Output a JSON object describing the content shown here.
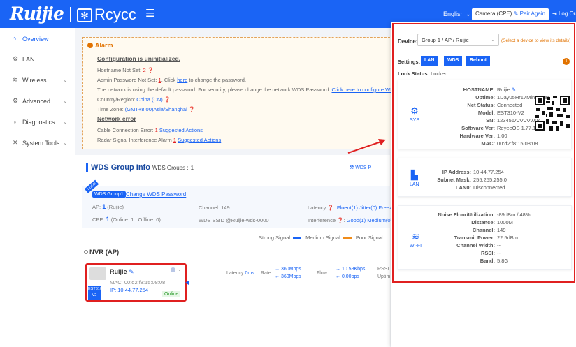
{
  "header": {
    "brand_logo": "Ruijie",
    "reyee_logo": "Rcycc",
    "menu_icon": "hamburger-icon",
    "language": "English",
    "camera_button_label": "Camera (CPE)",
    "pair_again_label": "Pair Again",
    "logout_label": "Log Out"
  },
  "sidebar": {
    "items": [
      {
        "label": "Overview",
        "icon": "home-icon"
      },
      {
        "label": "LAN",
        "icon": "network-icon"
      },
      {
        "label": "Wireless",
        "icon": "wifi-icon"
      },
      {
        "label": "Advanced",
        "icon": "gear-icon"
      },
      {
        "label": "Diagnostics",
        "icon": "stethoscope-icon"
      },
      {
        "label": "System Tools",
        "icon": "tools-icon"
      }
    ]
  },
  "alarm": {
    "title": "Alarm",
    "config_heading": "Configuration is uninitialized.",
    "hostname_text": "Hostname Not Set:",
    "hostname_count": "2",
    "admin_pw_text": "Admin Password Not Set:",
    "admin_pw_count": "1",
    "admin_pw_click": ". Click",
    "admin_pw_here": "here",
    "admin_pw_rest": "to change the password.",
    "default_pw_text": "The network is using the default password. For security, please change the network WDS Password.",
    "default_pw_link": "Click here to configure WDS Password.",
    "country_label": "Country/Region:",
    "country_value": "China (CN)",
    "timezone_label": "Time Zone:",
    "timezone_value": "(GMT+8:00)Asia/Shanghai",
    "network_heading": "Network error",
    "cable_text": "Cable Connection Error:",
    "cable_count": "1",
    "cable_action": "Suggested Actions",
    "radar_text": "Radar Signal Interference Alarm",
    "radar_count": "1",
    "radar_action": "Suggested Actions"
  },
  "wds": {
    "title": "WDS Group Info",
    "groups_label": "WDS Groups :",
    "groups_count": "1",
    "top_link": "WDS P",
    "local_tag": "Local",
    "group_button": "WDS Group1",
    "change_pw_link": "Change WDS Password",
    "ap_label": "AP:",
    "ap_count": "1",
    "ap_name": "(Ruijie)",
    "channel_label": "Channel :",
    "channel_value": "149",
    "latency_label": "Latency",
    "latency_fluent": "Fluent(1)",
    "latency_jitter": "Jitter(0)",
    "latency_freeze": "Freeze(",
    "cpe_label": "CPE:",
    "cpe_count": "1",
    "cpe_detail": "(Online: 1 , Offline: 0)",
    "ssid_label": "WDS SSID",
    "ssid_value": "@Ruijie-wds-0000",
    "interference_label": "Interference",
    "interference_good": "Good(1)",
    "interference_medium": "Medium(0)",
    "interference_p": "P",
    "legend_strong": "Strong Signal",
    "legend_medium": "Medium Signal",
    "legend_poor": "Poor Signal",
    "legend_colors": {
      "strong": "#1a64f5",
      "medium": "#f08c1a",
      "poor": "#e02020"
    },
    "nvr_label": "NVR (AP)",
    "device": {
      "name": "Ruijie",
      "mac_label": "MAC:",
      "mac": "00:d2:f8:15:08:08",
      "ip_label": "IP:",
      "ip": "10.44.77.254",
      "model_badge": "EST310-V2",
      "status": "Online"
    },
    "link": {
      "latency_label": "Latency",
      "latency_value": "0ms",
      "rate_label": "Rate",
      "rate_up": "360Mbps",
      "rate_down": "360Mbps",
      "flow_label": "Flow",
      "flow_up": "10.58Kbps",
      "flow_down": "0.00bps",
      "rssi_label": "RSSI",
      "uptime_label": "Uptim"
    }
  },
  "panel": {
    "device_label": "Device:",
    "device_value": "Group 1 / AP / Ruijie",
    "device_hint": "(Select a device to view its details)",
    "settings_label": "Settings:",
    "settings_buttons": [
      "LAN",
      "WDS",
      "Reboot"
    ],
    "lock_label": "Lock Status:",
    "lock_value": "Locked",
    "sys": {
      "icon_label": "SYS",
      "fields": [
        {
          "k": "HOSTNAME:",
          "v": "Ruijie"
        },
        {
          "k": "Uptime:",
          "v": "1Day05Hr17Min22Sec"
        },
        {
          "k": "Net Status:",
          "v": "Connected"
        },
        {
          "k": "Model:",
          "v": "EST310-V2"
        },
        {
          "k": "SN:",
          "v": "123456AAAAA004"
        },
        {
          "k": "Software Ver:",
          "v": "ReyeeOS 1.77.1415"
        },
        {
          "k": "Hardware Ver:",
          "v": "1.00"
        },
        {
          "k": "MAC:",
          "v": "00:d2:f8:15:08:08"
        }
      ]
    },
    "lan": {
      "icon_label": "LAN",
      "fields": [
        {
          "k": "IP Address:",
          "v": "10.44.77.254"
        },
        {
          "k": "Subnet Mask:",
          "v": "255.255.255.0"
        },
        {
          "k": "LAN0:",
          "v": "Disconnected"
        }
      ]
    },
    "wifi": {
      "icon_label": "WI-FI",
      "fields": [
        {
          "k": "Noise Floor/Utilization:",
          "v": "-89dBm / 48%"
        },
        {
          "k": "Distance:",
          "v": "1000M"
        },
        {
          "k": "Channel:",
          "v": "149"
        },
        {
          "k": "Transmit Power:",
          "v": "22.5dBm"
        },
        {
          "k": "Channel Width:",
          "v": "--"
        },
        {
          "k": "RSSI:",
          "v": "--"
        },
        {
          "k": "Band:",
          "v": "5.8G"
        }
      ]
    }
  }
}
